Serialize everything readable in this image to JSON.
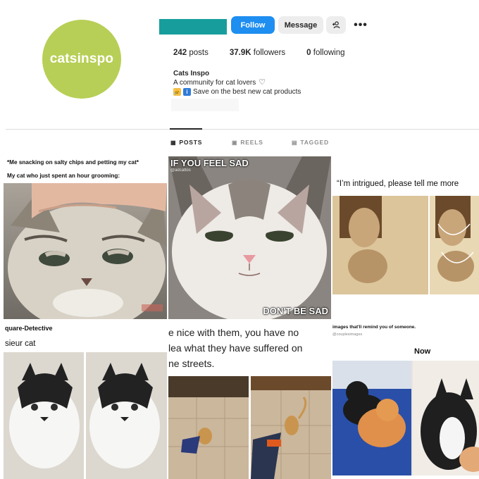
{
  "profile": {
    "avatar_text": "catsinspo",
    "follow_label": "Follow",
    "message_label": "Message",
    "add_user_icon": "add-user-icon",
    "more_icon": "more-options-icon",
    "stats": {
      "posts": "242",
      "posts_label": "posts",
      "followers": "37.9K",
      "followers_label": "followers",
      "following": "0",
      "following_label": "following"
    },
    "bio": {
      "name": "Cats Inspo",
      "line1": "A community for cat lovers",
      "line2": "Save on the best new cat products"
    }
  },
  "tabs": [
    {
      "label": "POSTS",
      "icon": "grid-icon",
      "active": true
    },
    {
      "label": "REELS",
      "icon": "reels-icon",
      "active": false
    },
    {
      "label": "TAGGED",
      "icon": "tagged-icon",
      "active": false
    }
  ],
  "posts": {
    "p1": {
      "caption1": "*Me snacking on salty chips and petting my cat*",
      "caption2": "My cat who just spent an hour grooming:"
    },
    "p2": {
      "top": "IF YOU FEEL SAD",
      "handle": "@adcattos",
      "bottom": "DON'T BE SAD"
    },
    "p3": {
      "caption": "“I’m intrigued, please tell me more"
    },
    "p4": {
      "caption1": "quare-Detective",
      "caption2": "sieur cat"
    },
    "p5": {
      "line1": "e nice with them, you have no",
      "line2": "lea what they have suffered on",
      "line3": "ne streets."
    },
    "p6": {
      "header": "images that'll remind you of someone.",
      "handle": "@couplesimages",
      "now": "Now"
    }
  },
  "colors": {
    "avatar_bg": "#b7cf56",
    "follow_bg": "#1e8ef0",
    "username_redaction": "#179e9c"
  }
}
